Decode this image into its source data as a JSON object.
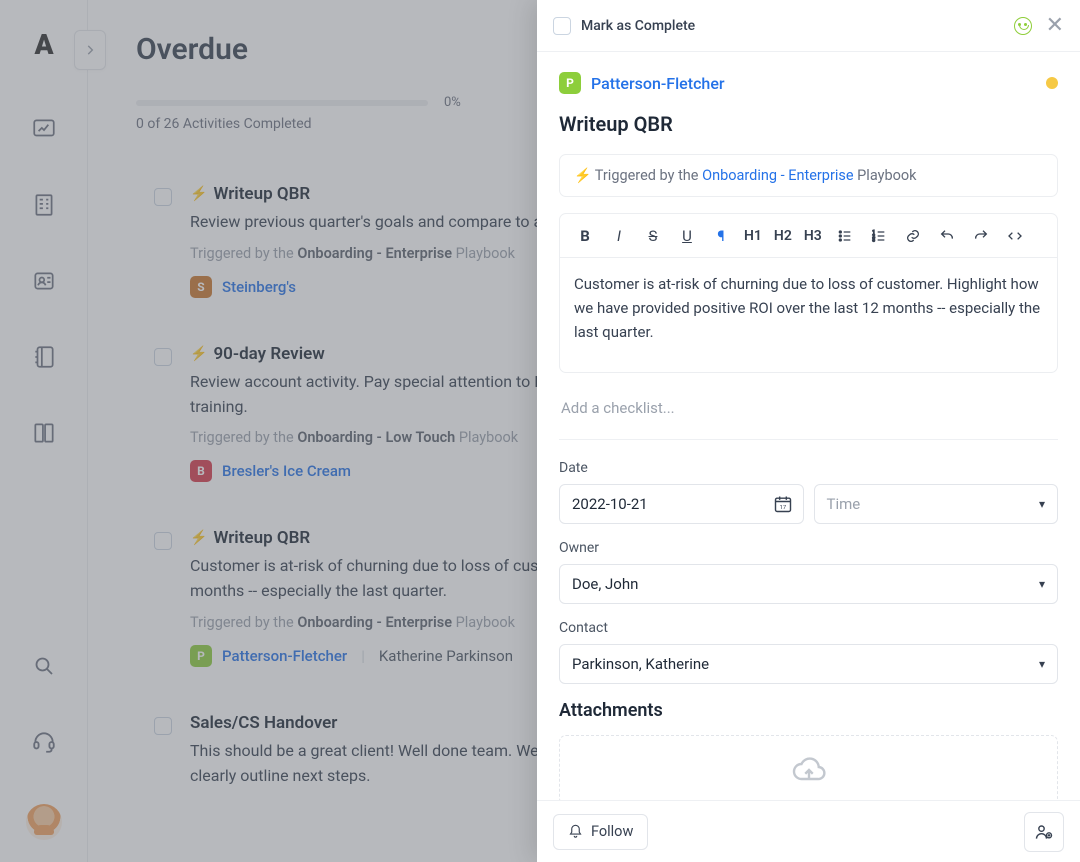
{
  "page": {
    "title": "Overdue",
    "progress_pct": "0%",
    "progress_sub": "0 of 26 Activities Completed"
  },
  "items": [
    {
      "title": "Writeup QBR",
      "desc": "Review previous quarter's goals and compare to actuals. Create plan for next quarter in Akita.",
      "trigger_prefix": "Triggered by the ",
      "trigger_playbook": "Onboarding - Enterprise",
      "trigger_suffix": " Playbook",
      "account_initial": "S",
      "account_name": "Steinberg's",
      "account_color": "#c9762e",
      "contact": ""
    },
    {
      "title": "90-day Review",
      "desc": "Review account activity. Pay special attention to DAU/MAU ratio. If necessary, schedule a call or offer additional training.",
      "trigger_prefix": "Triggered by the ",
      "trigger_playbook": "Onboarding - Low Touch",
      "trigger_suffix": " Playbook",
      "account_initial": "B",
      "account_name": "Bresler's Ice Cream",
      "account_color": "#d63a4a",
      "contact": ""
    },
    {
      "title": "Writeup QBR",
      "desc": "Customer is at-risk of churning due to loss of customer. Highlight how we have provided positive ROI over the last 12 months -- especially the last quarter.",
      "trigger_prefix": "Triggered by the ",
      "trigger_playbook": "Onboarding - Enterprise",
      "trigger_suffix": " Playbook",
      "account_initial": "P",
      "account_name": "Patterson-Fletcher",
      "account_color": "#8dce3b",
      "contact": "Katherine Parkinson"
    },
    {
      "title": "Sales/CS Handover",
      "desc": "This should be a great client! Well done team. We have potential to grow considerably within their organization. Let's clearly outline next steps.",
      "trigger_prefix": "",
      "trigger_playbook": "",
      "trigger_suffix": "",
      "account_initial": "",
      "account_name": "",
      "account_color": "",
      "contact": ""
    }
  ],
  "panel": {
    "mark_complete": "Mark as Complete",
    "account_initial": "P",
    "account_name": "Patterson-Fletcher",
    "task_title": "Writeup QBR",
    "trigger_prefix": "Triggered by the ",
    "trigger_link": "Onboarding - Enterprise",
    "trigger_suffix": " Playbook",
    "editor_text": "Customer is at-risk of churning due to loss of customer. Highlight how we have provided positive ROI over the last 12 months -- especially the last quarter.",
    "checklist_placeholder": "Add a checklist...",
    "date_label": "Date",
    "date_value": "2022-10-21",
    "time_placeholder": "Time",
    "owner_label": "Owner",
    "owner_value": "Doe, John",
    "contact_label": "Contact",
    "contact_value": "Parkinson, Katherine",
    "attachments_label": "Attachments",
    "follow_label": "Follow",
    "toolbar": {
      "h1": "H1",
      "h2": "H2",
      "h3": "H3"
    }
  }
}
